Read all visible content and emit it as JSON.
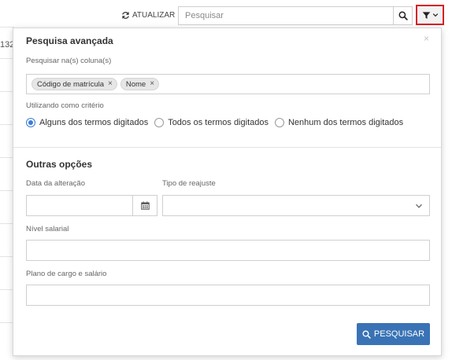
{
  "background": {
    "fragment_text": "132"
  },
  "toolbar": {
    "refresh_label": "ATUALIZAR",
    "refresh_icon": "refresh-icon",
    "search_placeholder": "Pesquisar",
    "search_value": "",
    "search_icon": "search-icon",
    "filter_icon": "filter-icon",
    "filter_chevron_icon": "chevron-down-icon"
  },
  "advanced_search": {
    "title": "Pesquisa avançada",
    "close_glyph": "×",
    "columns_label": "Pesquisar na(s) coluna(s)",
    "column_tags": [
      {
        "label": "Código de matrícula",
        "remove_glyph": "×"
      },
      {
        "label": "Nome",
        "remove_glyph": "×"
      }
    ],
    "criteria_label": "Utilizando como critério",
    "criteria_options": [
      {
        "label": "Alguns dos termos digitados",
        "checked": true
      },
      {
        "label": "Todos os termos digitados",
        "checked": false
      },
      {
        "label": "Nenhum dos termos digitados",
        "checked": false
      }
    ]
  },
  "other_options": {
    "title": "Outras opções",
    "date_label": "Data da alteração",
    "date_value": "",
    "readjust_label": "Tipo de reajuste",
    "readjust_value": "",
    "salary_level_label": "Nível salarial",
    "salary_level_value": "",
    "plan_label": "Plano de cargo e salário",
    "plan_value": ""
  },
  "submit": {
    "label": "PESQUISAR",
    "icon": "search-icon"
  },
  "colors": {
    "accent": "#3a73b5",
    "highlight_border": "#d81f26",
    "radio_checked": "#3b7dd8"
  }
}
